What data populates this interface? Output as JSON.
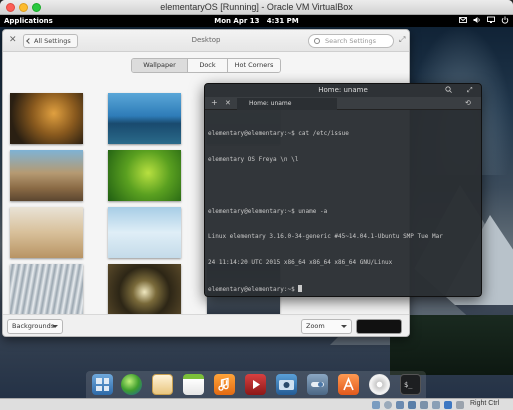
{
  "host_window": {
    "title": "elementaryOS [Running] - Oracle VM VirtualBox"
  },
  "panel": {
    "applications": "Applications",
    "clock": "Mon Apr 13   4:31 PM"
  },
  "settings": {
    "back_label": "All Settings",
    "title": "Desktop",
    "search_placeholder": "Search Settings",
    "tabs": [
      {
        "label": "Wallpaper",
        "active": true
      },
      {
        "label": "Dock",
        "active": false
      },
      {
        "label": "Hot Corners",
        "active": false
      }
    ],
    "wallpapers": [
      "leaves-on-ground",
      "lake-with-trees",
      "mountain-scene",
      "rocky-beach",
      "green-leaves",
      "sand-dunes",
      "clouds",
      "light-rays",
      "tunnel-tree"
    ],
    "footer": {
      "mode": "Backgrounds",
      "scale": "Zoom",
      "color": "#111111"
    }
  },
  "terminal": {
    "title": "Home: uname",
    "tab_label": "Home: uname",
    "lines": [
      "elementary@elementary:~$ cat /etc/issue",
      "elementary OS Freya \\n \\l",
      "",
      "elementary@elementary:~$ uname -a",
      "Linux elementary 3.16.0-34-generic #45~14.04.1-Ubuntu SMP Tue Mar",
      "24 11:14:20 UTC 2015 x86_64 x86_64 x86_64 GNU/Linux",
      "elementary@elementary:~$ "
    ]
  },
  "dock": {
    "apps": [
      "multitasking-view",
      "web-browser",
      "mail",
      "calendar",
      "music",
      "videos",
      "photos",
      "system-settings",
      "app-center",
      "dvd-drive",
      "terminal"
    ]
  },
  "statusbar": {
    "host_key": "Right Ctrl"
  }
}
